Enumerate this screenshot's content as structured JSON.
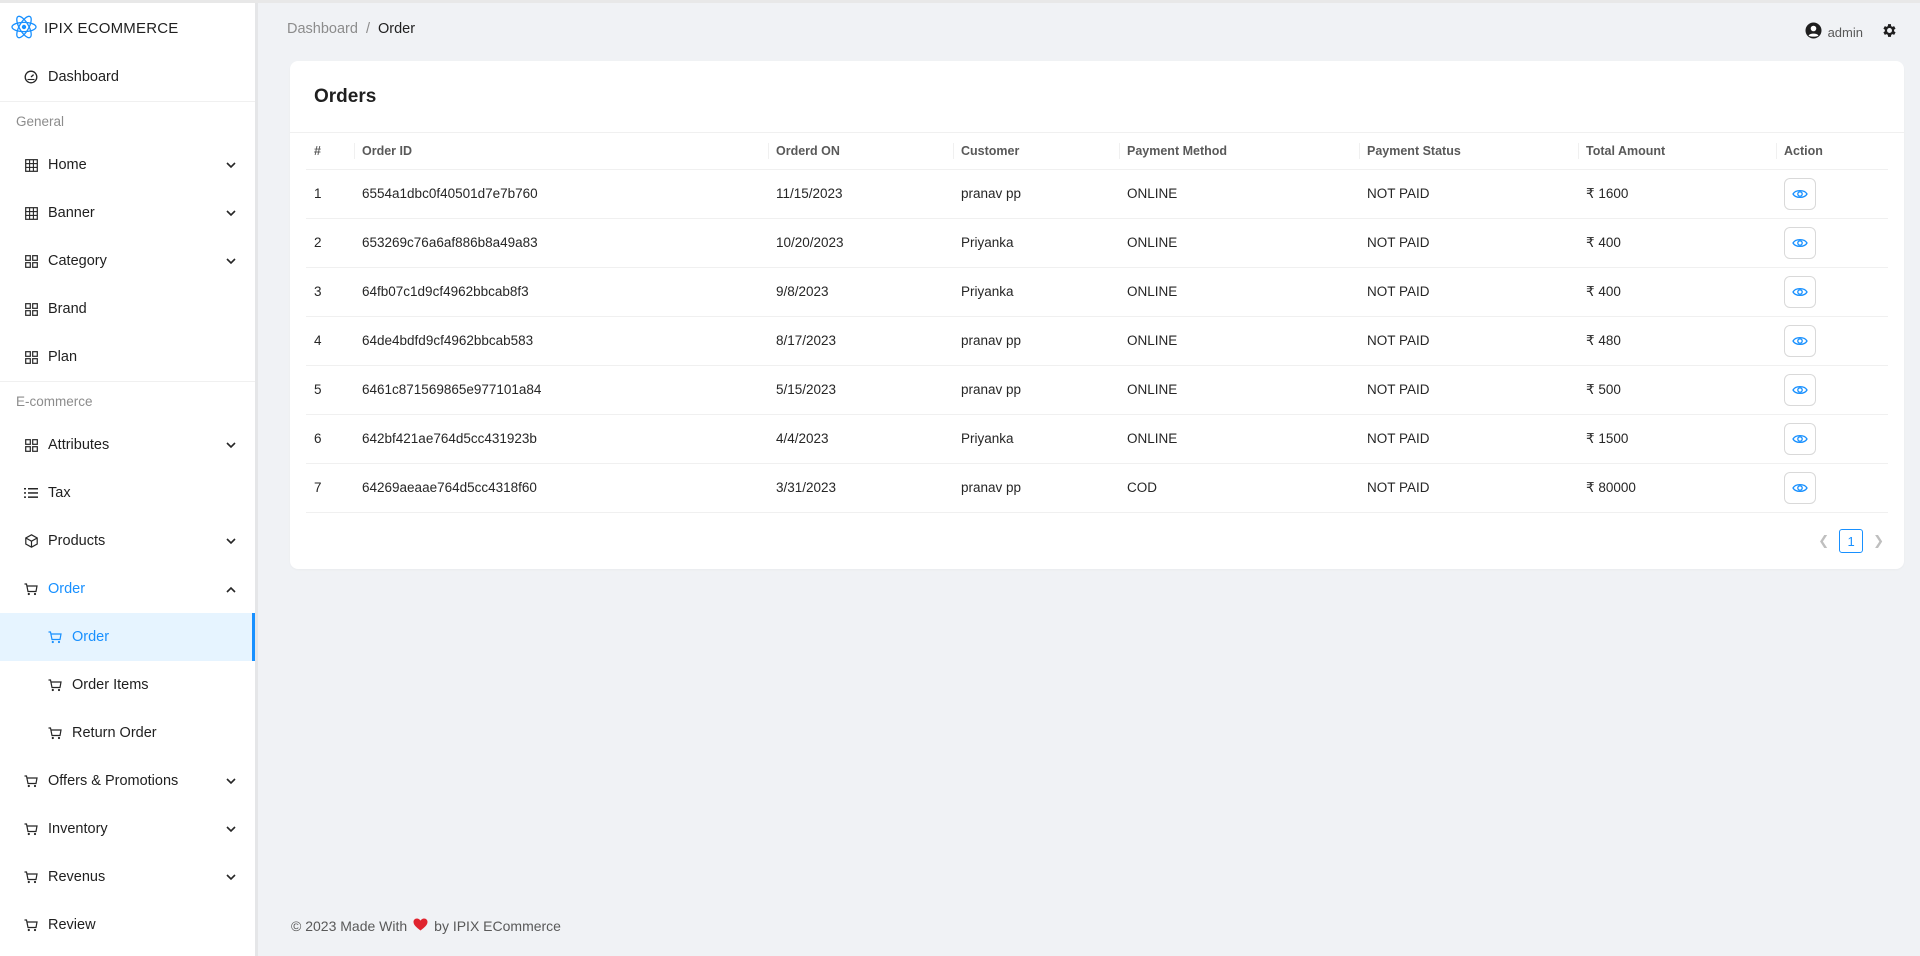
{
  "brand": {
    "name": "IPIX ECOMMERCE",
    "logo_icon": "react-atom-icon"
  },
  "sidebar": {
    "dashboard": "Dashboard",
    "groups": {
      "general": "General",
      "ecommerce": "E-commerce"
    },
    "general_items": [
      {
        "label": "Home",
        "icon": "table-icon",
        "chevron": true
      },
      {
        "label": "Banner",
        "icon": "table-icon",
        "chevron": true
      },
      {
        "label": "Category",
        "icon": "appstore-icon",
        "chevron": true
      },
      {
        "label": "Brand",
        "icon": "appstore-icon",
        "chevron": false
      },
      {
        "label": "Plan",
        "icon": "appstore-icon",
        "chevron": false
      }
    ],
    "ecommerce_items": {
      "attributes": "Attributes",
      "tax": "Tax",
      "products": "Products",
      "order": "Order",
      "order_sub": [
        "Order",
        "Order Items",
        "Return Order"
      ],
      "offers": "Offers & Promotions",
      "inventory": "Inventory",
      "revenue": "Revenus",
      "review": "Review"
    }
  },
  "header": {
    "breadcrumb": [
      "Dashboard",
      "/",
      "Order"
    ],
    "user": "admin"
  },
  "orders": {
    "title": "Orders",
    "columns": [
      "#",
      "Order ID",
      "Orderd ON",
      "Customer",
      "Payment Method",
      "Payment Status",
      "Total Amount",
      "Action"
    ],
    "rows": [
      {
        "n": "1",
        "id": "6554a1dbc0f40501d7e7b760",
        "date": "11/15/2023",
        "customer": "pranav pp",
        "method": "ONLINE",
        "status": "NOT PAID",
        "amount": "₹ 1600"
      },
      {
        "n": "2",
        "id": "653269c76a6af886b8a49a83",
        "date": "10/20/2023",
        "customer": "Priyanka",
        "method": "ONLINE",
        "status": "NOT PAID",
        "amount": "₹ 400"
      },
      {
        "n": "3",
        "id": "64fb07c1d9cf4962bbcab8f3",
        "date": "9/8/2023",
        "customer": "Priyanka",
        "method": "ONLINE",
        "status": "NOT PAID",
        "amount": "₹ 400"
      },
      {
        "n": "4",
        "id": "64de4bdfd9cf4962bbcab583",
        "date": "8/17/2023",
        "customer": "pranav pp",
        "method": "ONLINE",
        "status": "NOT PAID",
        "amount": "₹ 480"
      },
      {
        "n": "5",
        "id": "6461c871569865e977101a84",
        "date": "5/15/2023",
        "customer": "pranav pp",
        "method": "ONLINE",
        "status": "NOT PAID",
        "amount": "₹ 500"
      },
      {
        "n": "6",
        "id": "642bf421ae764d5cc431923b",
        "date": "4/4/2023",
        "customer": "Priyanka",
        "method": "ONLINE",
        "status": "NOT PAID",
        "amount": "₹ 1500"
      },
      {
        "n": "7",
        "id": "64269aeaae764d5cc4318f60",
        "date": "3/31/2023",
        "customer": "pranav pp",
        "method": "COD",
        "status": "NOT PAID",
        "amount": "₹ 80000"
      }
    ],
    "page": "1"
  },
  "footer": {
    "prefix": "© 2023 Made With",
    "suffix": "by IPIX ECommerce"
  },
  "colors": {
    "accent": "#1890ff",
    "heart": "#e0242e"
  }
}
